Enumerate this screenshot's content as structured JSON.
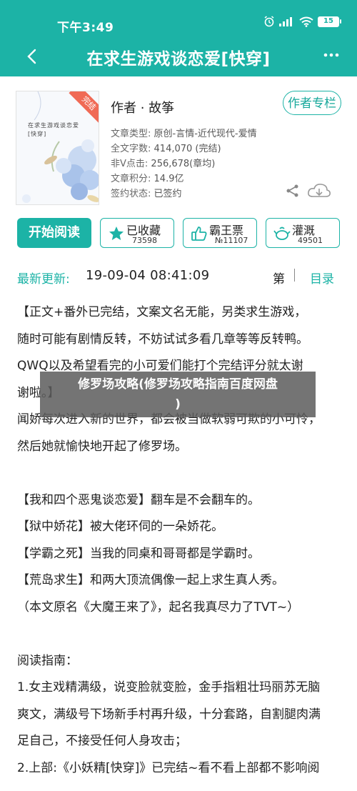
{
  "status_bar": {
    "time": "下午3:49",
    "battery": "15"
  },
  "header": {
    "title": "在求生游戏谈恋爱[快穿]"
  },
  "book": {
    "cover_badge": "完结",
    "cover_title": "在求生游戏谈恋爱[快穿]",
    "author_label": "作者 · 故筝",
    "author_column_button": "作者专栏",
    "meta": [
      {
        "key": "文章类型:",
        "value": "原创-言情-近代现代-爱情"
      },
      {
        "key": "全文字数:",
        "value": "414,070 (完结)"
      },
      {
        "key": "非V点击:",
        "value": "256,678(章均)"
      },
      {
        "key": "文章积分:",
        "value": "14.9亿"
      },
      {
        "key": "签约状态:",
        "value": "已签约"
      }
    ]
  },
  "actions": {
    "read_label": "开始阅读",
    "favorite": {
      "label": "已收藏",
      "count": "73598"
    },
    "vote": {
      "label": "霸王票",
      "count": "№11107"
    },
    "water": {
      "label": "灌溉",
      "count": "49501"
    }
  },
  "latest": {
    "label": "最新更新:",
    "date": "19-09-04 08:41:09",
    "chapter": "第",
    "toc": "目录"
  },
  "description": [
    "【正文+番外已完结，文案文名无能，另类求生游戏，",
    "随时可能有剧情反转，不妨试试多看几章等等反转鸭。",
    "QWQ以及希望看完的小可爱们能打个完结评分就太谢",
    "谢啦。】",
    "闻娇每次进入新的世界，都会被当做软弱可欺的小可怜，",
    "然后她就愉快地开起了修罗场。",
    "",
    "【我和四个恶鬼谈恋爱】翻车是不会翻车的。",
    "【狱中娇花】被大佬环伺的一朵娇花。",
    "【学霸之死】当我的同桌和哥哥都是学霸时。",
    "【荒岛求生】和两大顶流偶像一起上求生真人秀。",
    "（本文原名《大魔王来了》，起名我真尽力了TVT~）",
    "",
    "阅读指南：",
    "1.女主戏精满级，说变脸就变脸，金手指粗壮玛丽苏无脑",
    "爽文，满级号下场新手村再升级，十分套路，自割腿肉满",
    "足自己，不接受任何人身攻击；",
    "2.上部:《小妖精[快穿]》已完结~看不看上部都不影响阅"
  ],
  "overlay": {
    "line1": "修罗场攻略(修罗场攻略指南百度网盘",
    "line2": ")"
  },
  "colors": {
    "accent": "#1cb3a6",
    "cover_badge": "#f06a55",
    "overlay": "#5c5c5c"
  },
  "icons": [
    "back-arrow-icon",
    "more-dots-icon",
    "share-icon",
    "cloud-download-icon",
    "star-icon",
    "thumb-up-icon",
    "water-can-icon",
    "signal-icon",
    "wifi-icon",
    "battery-icon",
    "alarm-icon"
  ]
}
